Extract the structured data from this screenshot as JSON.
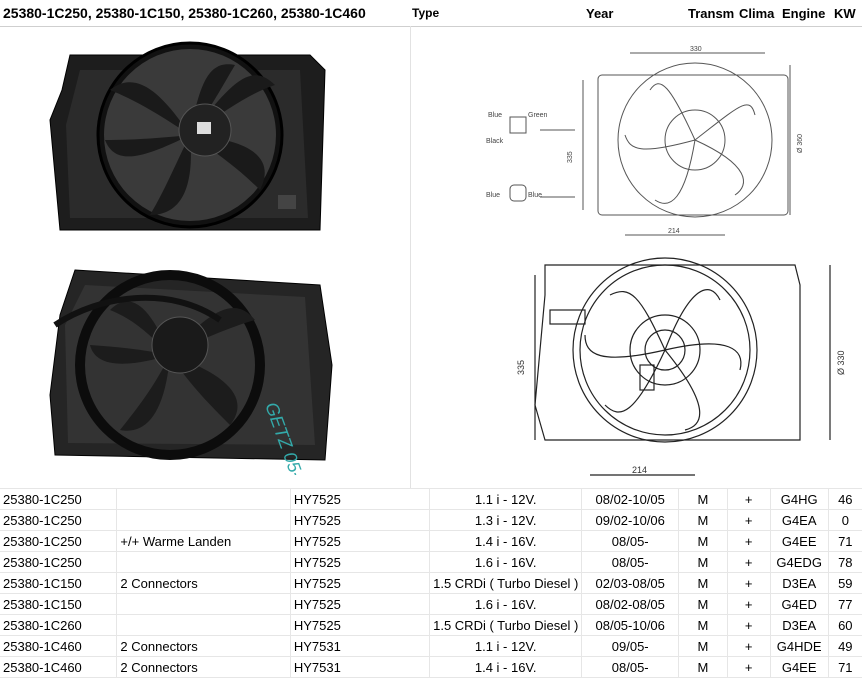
{
  "header": {
    "title": "25380-1C250, 25380-1C150, 25380-1C260, 25380-1C460",
    "type_label": "Type",
    "year_label": "Year",
    "transm_label": "Transm",
    "clima_label": "Clima",
    "engine_label": "Engine",
    "kw_label": "KW"
  },
  "diagram_top": {
    "width_dim": "330",
    "height_dim": "335",
    "diameter_dim": "Ø 360",
    "bottom_dim": "214",
    "connector1_labels": [
      "Blue",
      "Green",
      "Black"
    ],
    "connector2_labels": [
      "Blue",
      "Blue"
    ]
  },
  "diagram_bottom": {
    "height_dim": "335",
    "diameter_dim": "Ø 330",
    "bottom_dim": "214"
  },
  "photo_note": {
    "handwriting": "GETZ 05-"
  },
  "rows": [
    {
      "part": "25380-1C250",
      "note": "",
      "type": "HY7525",
      "engine_desc": "1.1 i - 12V.",
      "year": "08/02-10/05",
      "transm": "M",
      "clima": "+",
      "engine": "G4HG",
      "kw": "46"
    },
    {
      "part": "25380-1C250",
      "note": "",
      "type": "HY7525",
      "engine_desc": "1.3 i - 12V.",
      "year": "09/02-10/06",
      "transm": "M",
      "clima": "+",
      "engine": "G4EA",
      "kw": "0"
    },
    {
      "part": "25380-1C250",
      "note": "+/+ Warme Landen",
      "type": "HY7525",
      "engine_desc": "1.4 i - 16V.",
      "year": "08/05-",
      "transm": "M",
      "clima": "+",
      "engine": "G4EE",
      "kw": "71"
    },
    {
      "part": "25380-1C250",
      "note": "",
      "type": "HY7525",
      "engine_desc": "1.6 i - 16V.",
      "year": "08/05-",
      "transm": "M",
      "clima": "+",
      "engine": "G4EDG",
      "kw": "78"
    },
    {
      "part": "25380-1C150",
      "note": "2 Connectors",
      "type": "HY7525",
      "engine_desc": "1.5 CRDi ( Turbo Diesel )",
      "year": "02/03-08/05",
      "transm": "M",
      "clima": "+",
      "engine": "D3EA",
      "kw": "59"
    },
    {
      "part": "25380-1C150",
      "note": "",
      "type": "HY7525",
      "engine_desc": "1.6 i - 16V.",
      "year": "08/02-08/05",
      "transm": "M",
      "clima": "+",
      "engine": "G4ED",
      "kw": "77"
    },
    {
      "part": "25380-1C260",
      "note": "",
      "type": "HY7525",
      "engine_desc": "1.5 CRDi ( Turbo Diesel )",
      "year": "08/05-10/06",
      "transm": "M",
      "clima": "+",
      "engine": "D3EA",
      "kw": "60"
    },
    {
      "part": "25380-1C460",
      "note": "2 Connectors",
      "type": "HY7531",
      "engine_desc": "1.1 i - 12V.",
      "year": "09/05-",
      "transm": "M",
      "clima": "+",
      "engine": "G4HDE",
      "kw": "49"
    },
    {
      "part": "25380-1C460",
      "note": "2 Connectors",
      "type": "HY7531",
      "engine_desc": "1.4 i - 16V.",
      "year": "08/05-",
      "transm": "M",
      "clima": "+",
      "engine": "G4EE",
      "kw": "71"
    }
  ]
}
